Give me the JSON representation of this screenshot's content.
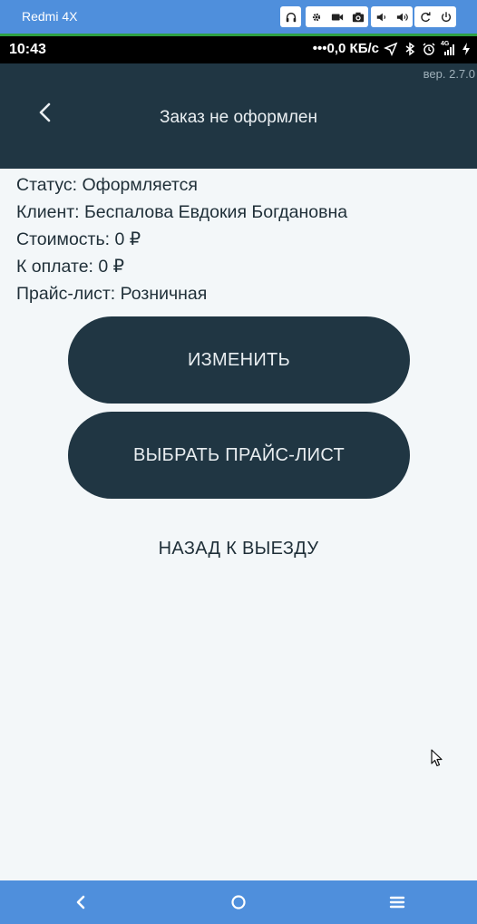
{
  "window": {
    "title": "Redmi 4X",
    "controls": [
      "headphones-icon",
      "gear-icon",
      "video-icon",
      "camera-icon",
      "volume-down-icon",
      "volume-up-icon",
      "rotate-icon",
      "power-icon"
    ]
  },
  "status_bar": {
    "time": "10:43",
    "network_speed": "0,0 КБ/с",
    "network_type": "4G"
  },
  "header": {
    "version": "вер. 2.7.0",
    "title": "Заказ не оформлен"
  },
  "order": {
    "status": "Статус: Оформляется",
    "client": "Клиент: Беспалова Евдокия Богдановна",
    "cost": "Стоимость: 0 ₽",
    "to_pay": "К оплате: 0 ₽",
    "price_list": "Прайс-лист: Розничная"
  },
  "actions": {
    "change": "ИЗМЕНИТЬ",
    "choose_price_list": "ВЫБРАТЬ ПРАЙС-ЛИСТ",
    "back_to_trip": "НАЗАД К ВЫЕЗДУ"
  },
  "colors": {
    "header_bg": "#203643",
    "page_bg": "#f3f7f9",
    "chrome_blue": "#4f8fdc"
  }
}
